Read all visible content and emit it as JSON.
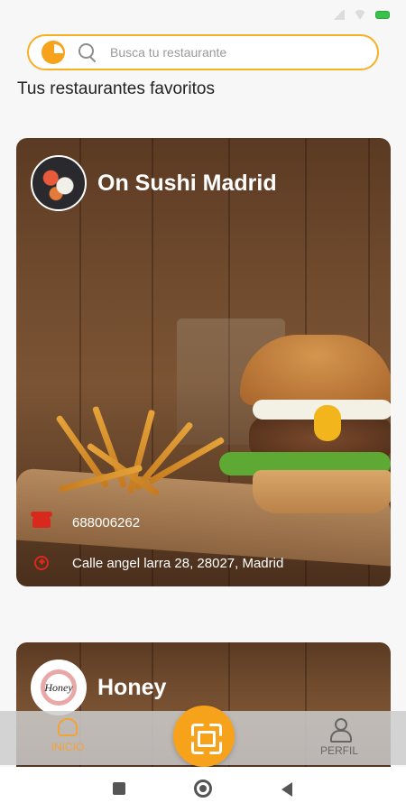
{
  "search": {
    "placeholder": "Busca tu restaurante"
  },
  "section_title": "Tus restaurantes favoritos",
  "restaurants": [
    {
      "name": "On Sushi Madrid",
      "phone": "688006262",
      "address": "Calle angel larra 28, 28027, Madrid"
    },
    {
      "name": "Honey",
      "logo_text": "Honey"
    }
  ],
  "nav": {
    "inicio_label": "INICIO",
    "perfil_label": "PERFIL"
  },
  "colors": {
    "accent": "#f7a21b",
    "search_border": "#f7b024",
    "icon_red": "#d9291c"
  }
}
